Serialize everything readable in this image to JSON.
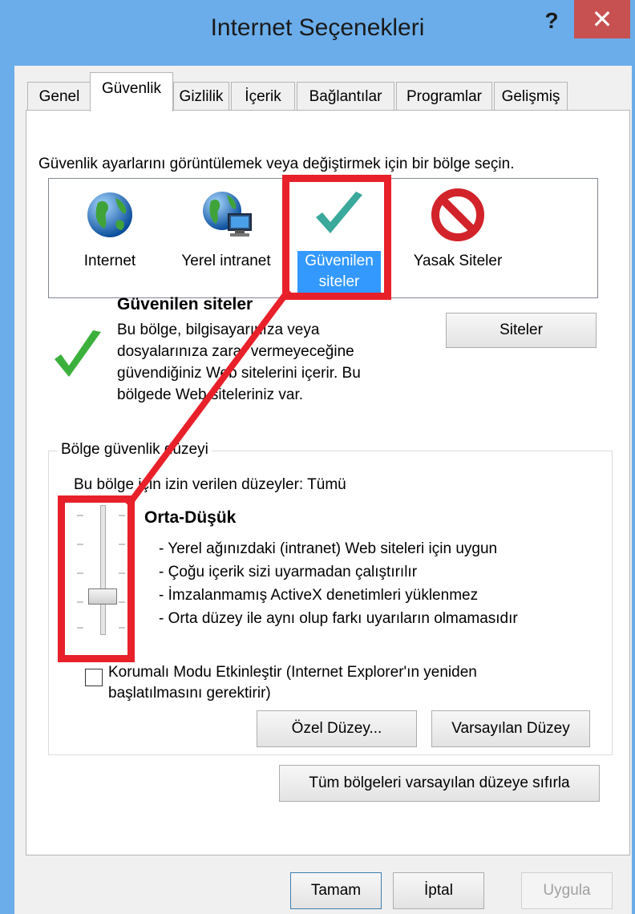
{
  "window": {
    "title": "Internet Seçenekleri",
    "help": "?",
    "close": "✕"
  },
  "tabs": [
    {
      "label": "Genel"
    },
    {
      "label": "Güvenlik"
    },
    {
      "label": "Gizlilik"
    },
    {
      "label": "İçerik"
    },
    {
      "label": "Bağlantılar"
    },
    {
      "label": "Programlar"
    },
    {
      "label": "Gelişmiş"
    }
  ],
  "security": {
    "instruction": "Güvenlik ayarlarını görüntülemek veya değiştirmek için bir bölge seçin.",
    "zones": [
      {
        "label": "Internet",
        "icon": "globe-icon"
      },
      {
        "label": "Yerel intranet",
        "icon": "intranet-globe-icon"
      },
      {
        "label": "Güvenilen siteler",
        "icon": "check-icon",
        "selected": true
      },
      {
        "label": "Yasak Siteler",
        "icon": "restricted-icon"
      }
    ],
    "selected_title": "Güvenilen siteler",
    "selected_desc": "Bu bölge, bilgisayarınıza veya dosyalarınıza zarar vermeyeceğine güvendiğiniz Web sitelerini içerir. Bu bölgede Web siteleriniz var.",
    "sites_button": "Siteler",
    "group_legend": "Bölge güvenlik düzeyi",
    "allowed_levels": "Bu bölge için izin verilen düzeyler: Tümü",
    "level_title": "Orta-Düşük",
    "level_items": [
      "- Yerel ağınızdaki (intranet) Web siteleri için uygun",
      "- Çoğu içerik sizi uyarmadan çalıştırılır",
      "- İmzalanmamış ActiveX denetimleri yüklenmez",
      "- Orta düzey ile aynı olup farkı uyarıların olmamasıdır"
    ],
    "slider_level": 2,
    "slider_levels": 5,
    "protected_mode_label": "Korumalı Modu Etkinleştir (Internet Explorer'ın yeniden başlatılmasını gerektirir)",
    "protected_mode_checked": false,
    "custom_level_button": "Özel Düzey...",
    "default_level_button": "Varsayılan Düzey",
    "reset_all_button": "Tüm bölgeleri varsayılan düzeye sıfırla"
  },
  "footer": {
    "ok": "Tamam",
    "cancel": "İptal",
    "apply": "Uygula"
  },
  "colors": {
    "titlebar": "#6badea",
    "close": "#c75050",
    "selection": "#3399ff",
    "highlight": "#e8202a"
  }
}
